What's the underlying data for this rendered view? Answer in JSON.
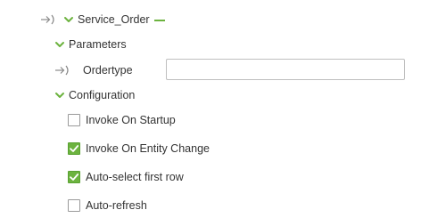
{
  "tree": {
    "root": {
      "label": "Service_Order",
      "icon": "input-arrow-icon",
      "expand_icon": "chevron-down-icon",
      "accent_color": "#6cb33f"
    },
    "parameters": {
      "label": "Parameters",
      "fields": [
        {
          "label": "Ordertype",
          "value": "",
          "placeholder": ""
        }
      ]
    },
    "configuration": {
      "label": "Configuration",
      "options": [
        {
          "label": "Invoke On Startup",
          "checked": false
        },
        {
          "label": "Invoke On Entity Change",
          "checked": true
        },
        {
          "label": "Auto-select first row",
          "checked": true
        },
        {
          "label": "Auto-refresh",
          "checked": false
        }
      ]
    }
  },
  "colors": {
    "accent": "#6cb33f",
    "text": "#333333",
    "icon_gray": "#8a8a8a",
    "border": "#bfbfbf"
  }
}
